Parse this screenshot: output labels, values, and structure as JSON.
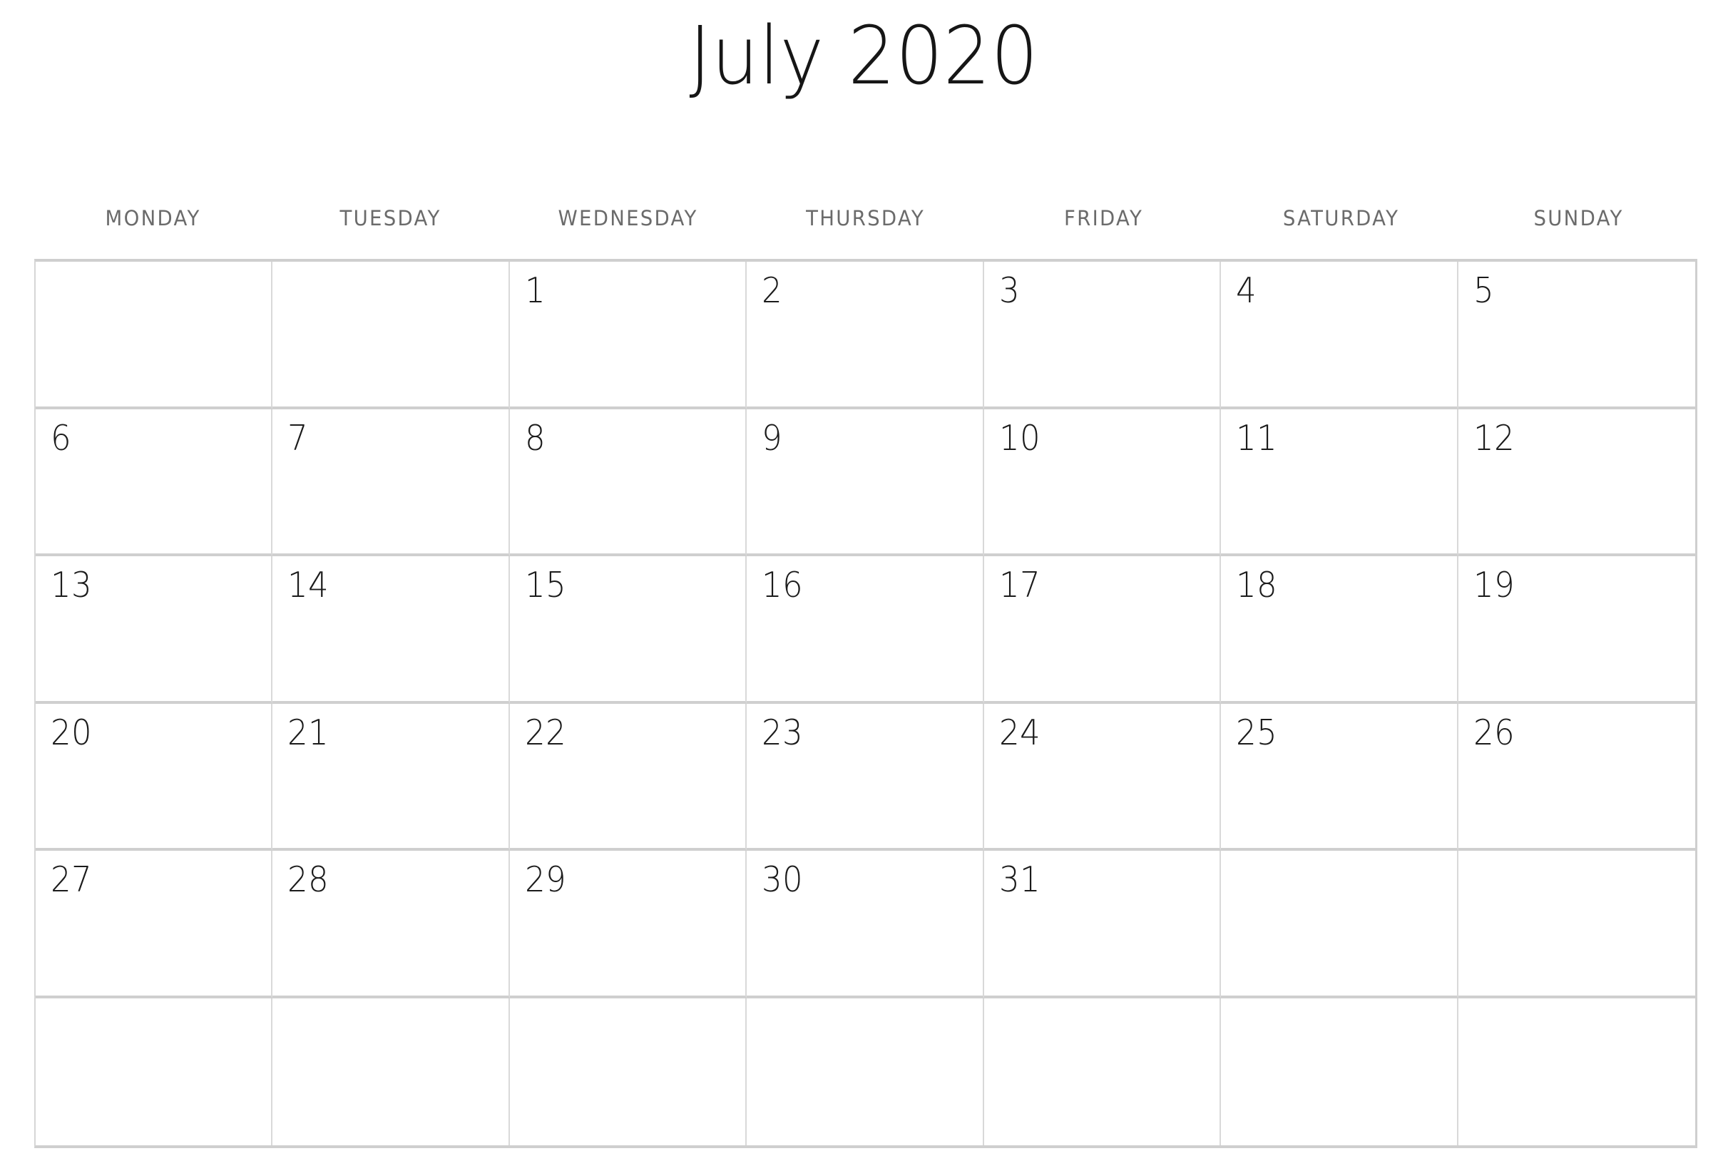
{
  "header": {
    "month_title": "July 2020",
    "month": "July",
    "year": "2020"
  },
  "weekdays": [
    {
      "label": "MONDAY"
    },
    {
      "label": "TUESDAY"
    },
    {
      "label": "WEDNESDAY"
    },
    {
      "label": "THURSDAY"
    },
    {
      "label": "FRIDAY"
    },
    {
      "label": "SATURDAY"
    },
    {
      "label": "SUNDAY"
    }
  ],
  "grid": {
    "columns": 7,
    "rows": 6,
    "week_start": "MONDAY",
    "weeks": [
      {
        "days": [
          "",
          "",
          "1",
          "2",
          "3",
          "4",
          "5"
        ]
      },
      {
        "days": [
          "6",
          "7",
          "8",
          "9",
          "10",
          "11",
          "12"
        ]
      },
      {
        "days": [
          "13",
          "14",
          "15",
          "16",
          "17",
          "18",
          "19"
        ]
      },
      {
        "days": [
          "20",
          "21",
          "22",
          "23",
          "24",
          "25",
          "26"
        ]
      },
      {
        "days": [
          "27",
          "28",
          "29",
          "30",
          "31",
          "",
          ""
        ]
      },
      {
        "days": [
          "",
          "",
          "",
          "",
          "",
          "",
          ""
        ]
      }
    ]
  },
  "colors": {
    "page_background": "#ffffff",
    "title_text": "#161616",
    "weekday_text": "#6b6b6b",
    "day_number_text": "#1b1b1b",
    "grid_line_vertical": "#d9d9d9",
    "grid_line_horizontal": "#cfcfcf"
  }
}
